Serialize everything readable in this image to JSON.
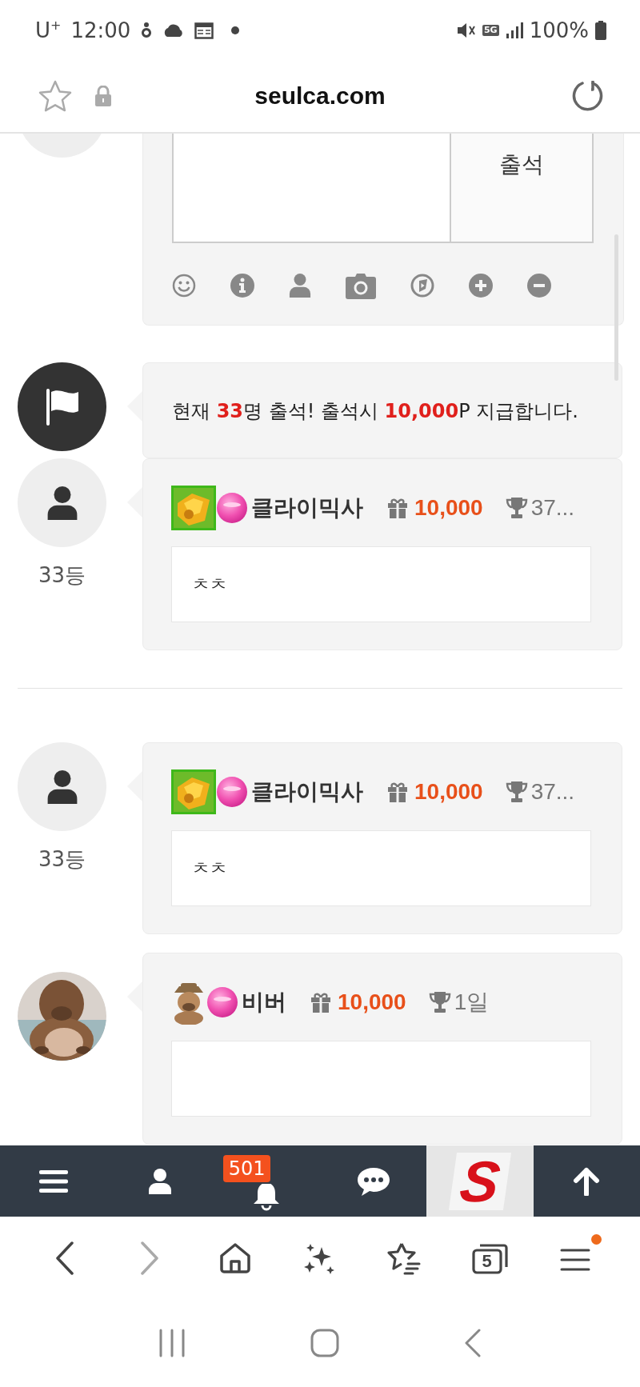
{
  "status_bar": {
    "carrier": "U$^{+}$",
    "time": "12:00",
    "network": "5G",
    "battery": "100%"
  },
  "address_bar": {
    "url": "seulca.com"
  },
  "attendance_form": {
    "button": "출석"
  },
  "notice": {
    "text": "현재 **33**명 출석! 출석시 **10,000**P 지급합니다."
  },
  "thread": [
    {
      "kind": "comment",
      "avatar": {
        "kind": "silhouette"
      },
      "rank": "33등",
      "level_icon": {
        "kind": "tile"
      },
      "name": "클라이믹사",
      "points": "10,000",
      "trophy": "37...",
      "text": "ㅊㅊ"
    },
    {
      "kind": "divider"
    },
    {
      "kind": "comment",
      "avatar": {
        "kind": "silhouette"
      },
      "rank": "33등",
      "level_icon": {
        "kind": "tile"
      },
      "name": "클라이믹사",
      "points": "10,000",
      "trophy": "37...",
      "text": "ㅊㅊ"
    },
    {
      "kind": "comment",
      "level_icon": {
        "kind": "figure"
      },
      "name": "비버",
      "points": "10,000",
      "trophy": "1일"
    }
  ],
  "bottom_nav": {
    "items": [
      {
        "kind": "menu"
      },
      {
        "kind": "user"
      },
      {
        "kind": "bell",
        "badge": "501"
      },
      {
        "kind": "chat"
      },
      {
        "kind": "logo",
        "text": "S"
      },
      {
        "kind": "top"
      }
    ]
  },
  "browser_toolbar": {
    "items": [
      {
        "kind": "back",
        "disabled": false
      },
      {
        "kind": "forward",
        "disabled": true
      },
      {
        "kind": "home",
        "disabled": false
      },
      {
        "kind": "sparkle",
        "disabled": false
      },
      {
        "kind": "bookmarks",
        "disabled": false
      },
      {
        "kind": "tabs",
        "count": "5",
        "disabled": false
      },
      {
        "kind": "menu",
        "disabled": false,
        "notification_dot": true
      }
    ]
  }
}
